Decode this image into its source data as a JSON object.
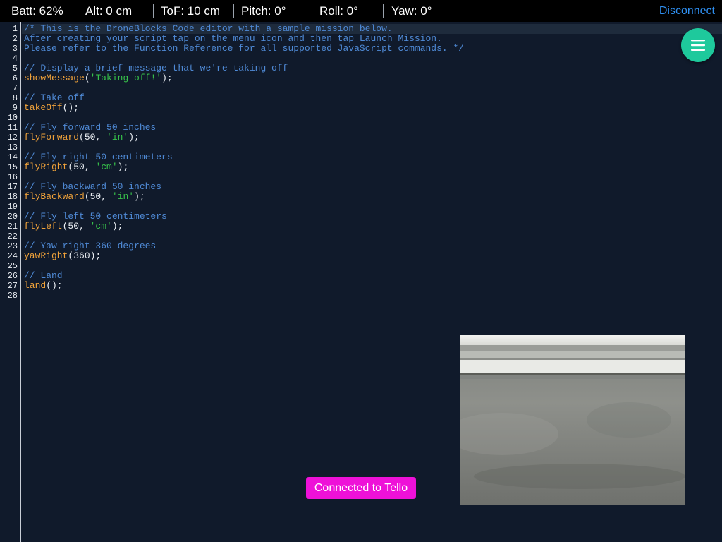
{
  "status_bar": {
    "battery": "Batt: 62%",
    "altitude": "Alt: 0 cm",
    "tof": "ToF: 10 cm",
    "pitch": "Pitch: 0°",
    "roll": "Roll: 0°",
    "yaw": "Yaw: 0°",
    "disconnect_label": "Disconnect"
  },
  "editor": {
    "active_line": 1,
    "lines": [
      [
        {
          "t": "comment",
          "v": "/* This is the DroneBlocks Code editor with a sample mission below."
        }
      ],
      [
        {
          "t": "comment",
          "v": "After creating your script tap on the menu icon and then tap Launch Mission."
        }
      ],
      [
        {
          "t": "comment",
          "v": "Please refer to the Function Reference for all supported JavaScript commands. */"
        }
      ],
      [],
      [
        {
          "t": "comment",
          "v": "// Display a brief message that we're taking off"
        }
      ],
      [
        {
          "t": "fn",
          "v": "showMessage"
        },
        {
          "t": "punc",
          "v": "("
        },
        {
          "t": "str",
          "v": "'Taking off!'"
        },
        {
          "t": "punc",
          "v": ");"
        }
      ],
      [],
      [
        {
          "t": "comment",
          "v": "// Take off"
        }
      ],
      [
        {
          "t": "fn",
          "v": "takeOff"
        },
        {
          "t": "punc",
          "v": "();"
        }
      ],
      [],
      [
        {
          "t": "comment",
          "v": "// Fly forward 50 inches"
        }
      ],
      [
        {
          "t": "fn",
          "v": "flyForward"
        },
        {
          "t": "punc",
          "v": "(50, "
        },
        {
          "t": "str",
          "v": "'in'"
        },
        {
          "t": "punc",
          "v": ");"
        }
      ],
      [],
      [
        {
          "t": "comment",
          "v": "// Fly right 50 centimeters"
        }
      ],
      [
        {
          "t": "fn",
          "v": "flyRight"
        },
        {
          "t": "punc",
          "v": "(50, "
        },
        {
          "t": "str",
          "v": "'cm'"
        },
        {
          "t": "punc",
          "v": ");"
        }
      ],
      [],
      [
        {
          "t": "comment",
          "v": "// Fly backward 50 inches"
        }
      ],
      [
        {
          "t": "fn",
          "v": "flyBackward"
        },
        {
          "t": "punc",
          "v": "(50, "
        },
        {
          "t": "str",
          "v": "'in'"
        },
        {
          "t": "punc",
          "v": ");"
        }
      ],
      [],
      [
        {
          "t": "comment",
          "v": "// Fly left 50 centimeters"
        }
      ],
      [
        {
          "t": "fn",
          "v": "flyLeft"
        },
        {
          "t": "punc",
          "v": "(50, "
        },
        {
          "t": "str",
          "v": "'cm'"
        },
        {
          "t": "punc",
          "v": ");"
        }
      ],
      [],
      [
        {
          "t": "comment",
          "v": "// Yaw right 360 degrees"
        }
      ],
      [
        {
          "t": "fn",
          "v": "yawRight"
        },
        {
          "t": "punc",
          "v": "(360);"
        }
      ],
      [],
      [
        {
          "t": "comment",
          "v": "// Land"
        }
      ],
      [
        {
          "t": "fn",
          "v": "land"
        },
        {
          "t": "punc",
          "v": "();"
        }
      ],
      []
    ]
  },
  "menu_button": {
    "icon": "hamburger-menu-icon"
  },
  "camera": {
    "icon": "camera-feed"
  },
  "toast": {
    "message": "Connected to Tello"
  },
  "colors": {
    "background": "#101a2b",
    "accent": "#1ec99c",
    "toast": "#ee11d8",
    "link": "#2f8ff0",
    "comment": "#4f8ad6",
    "function": "#f0a23a",
    "string": "#37c24a"
  }
}
